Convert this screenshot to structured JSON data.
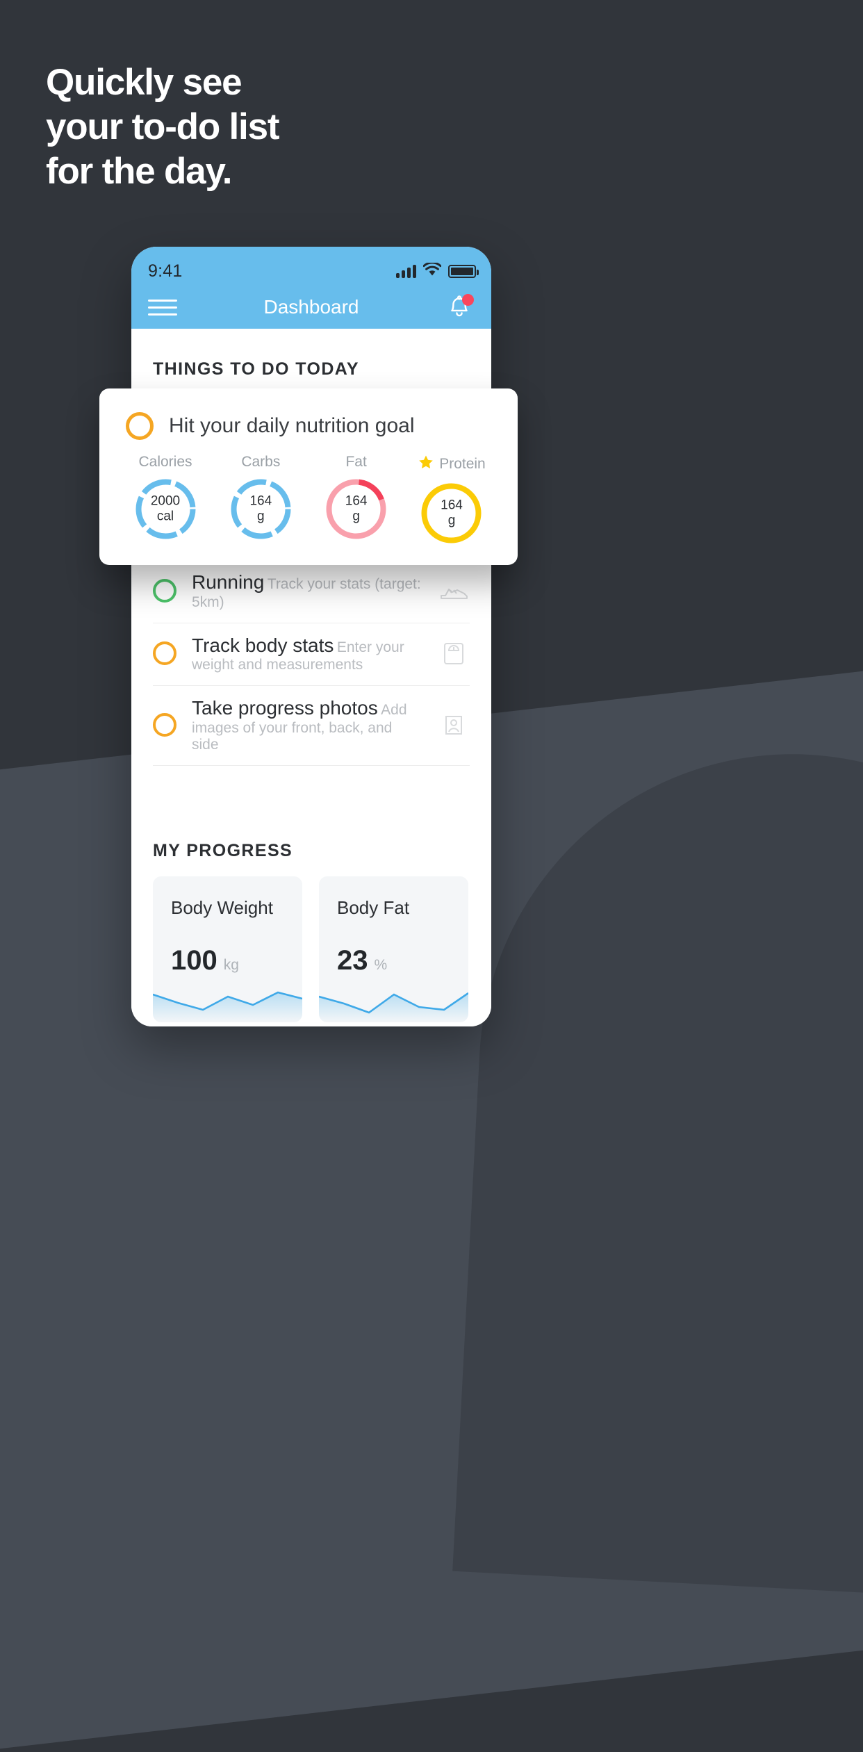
{
  "headline": {
    "line1": "Quickly see",
    "line2": "your to-do list",
    "line3": "for the day."
  },
  "colors": {
    "background": "#31353b",
    "accent_blue": "#67bdec",
    "accent_yellow": "#f5a623",
    "accent_green": "#4dc36a",
    "accent_red": "#f9465c",
    "protein_yellow": "#fbcb06",
    "card_bg": "#f4f6f8"
  },
  "phone": {
    "status_bar": {
      "time": "9:41",
      "icons": [
        "cellular-icon",
        "wifi-icon",
        "battery-icon"
      ]
    },
    "app_bar": {
      "menu_icon": "hamburger-menu-icon",
      "title": "Dashboard",
      "bell_icon": "notification-bell-icon",
      "has_badge": true
    },
    "todo_section": {
      "title": "THINGS TO DO TODAY",
      "tasks": [
        {
          "title": "Running",
          "subtitle": "Track your stats (target: 5km)",
          "ring_color": "green",
          "icon": "running-shoe-icon"
        },
        {
          "title": "Track body stats",
          "subtitle": "Enter your weight and measurements",
          "ring_color": "yellow",
          "icon": "weight-scale-icon"
        },
        {
          "title": "Take progress photos",
          "subtitle": "Add images of your front, back, and side",
          "ring_color": "yellow",
          "icon": "person-photo-icon"
        }
      ]
    },
    "progress_section": {
      "title": "MY PROGRESS",
      "cards": [
        {
          "title": "Body Weight",
          "value": "100",
          "unit": "kg"
        },
        {
          "title": "Body Fat",
          "value": "23",
          "unit": "%"
        }
      ]
    }
  },
  "nutrition_card": {
    "ring_color": "yellow",
    "title": "Hit your daily nutrition goal",
    "macros": [
      {
        "label": "Calories",
        "value": "2000",
        "unit": "cal",
        "color": "#67bdec",
        "starred": false,
        "progress": 88
      },
      {
        "label": "Carbs",
        "value": "164",
        "unit": "g",
        "color": "#67bdec",
        "starred": false,
        "progress": 88
      },
      {
        "label": "Fat",
        "value": "164",
        "unit": "g",
        "color": "#f9a0ac",
        "accent": "#f4415a",
        "starred": false,
        "progress": 100
      },
      {
        "label": "Protein",
        "value": "164",
        "unit": "g",
        "color": "#fbcb06",
        "starred": true,
        "progress": 100
      }
    ]
  },
  "chart_data": [
    {
      "type": "area",
      "title": "Body Weight",
      "ylabel": "kg",
      "x": [
        0,
        1,
        2,
        3,
        4,
        5,
        6
      ],
      "values": [
        44,
        30,
        18,
        35,
        24,
        40,
        33
      ],
      "series": [
        {
          "name": "Body Weight",
          "values": [
            44,
            30,
            18,
            35,
            24,
            40,
            33
          ]
        }
      ],
      "grid": false,
      "legend": "none"
    },
    {
      "type": "area",
      "title": "Body Fat",
      "ylabel": "%",
      "x": [
        0,
        1,
        2,
        3,
        4,
        5,
        6
      ],
      "values": [
        40,
        30,
        14,
        38,
        26,
        22,
        42
      ],
      "series": [
        {
          "name": "Body Fat",
          "values": [
            40,
            30,
            14,
            38,
            26,
            22,
            42
          ]
        }
      ],
      "grid": false,
      "legend": "none"
    }
  ]
}
